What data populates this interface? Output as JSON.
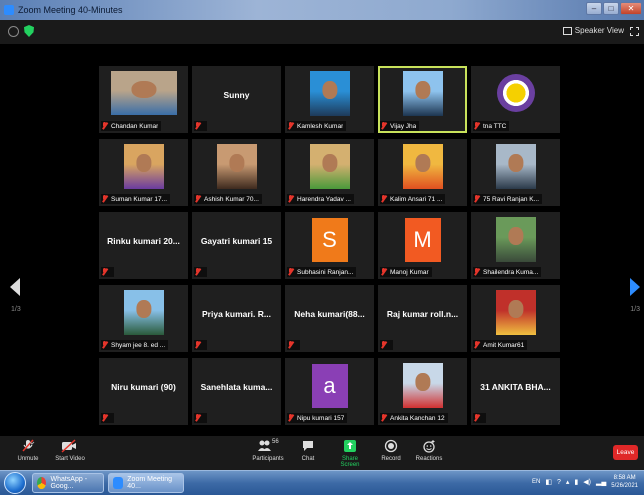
{
  "window": {
    "title": "Zoom Meeting 40-Minutes"
  },
  "topbar": {
    "view_label": "Speaker View"
  },
  "gallery": {
    "page_left": "1/3",
    "page_right": "1/3",
    "tiles": [
      {
        "name": "Chandan Kumar",
        "display": "",
        "type": "video"
      },
      {
        "name": "",
        "display": "Sunny",
        "type": "name"
      },
      {
        "name": "Kamlesh Kumar",
        "display": "",
        "type": "photo"
      },
      {
        "name": "Vijay Jha",
        "display": "",
        "type": "photo"
      },
      {
        "name": "tna TTC",
        "display": "",
        "type": "logo"
      },
      {
        "name": "Suman Kumar 17...",
        "display": "",
        "type": "photo"
      },
      {
        "name": "Ashish Kumar 70...",
        "display": "",
        "type": "photo"
      },
      {
        "name": "Harendra Yadav ...",
        "display": "",
        "type": "photo"
      },
      {
        "name": "Kalim Ansari 71 ...",
        "display": "",
        "type": "photo"
      },
      {
        "name": "75 Ravi Ranjan K...",
        "display": "",
        "type": "photo"
      },
      {
        "name": "",
        "display": "Rinku kumari 20...",
        "type": "name"
      },
      {
        "name": "",
        "display": "Gayatri kumari 15",
        "type": "name"
      },
      {
        "name": "Subhasini Ranjan...",
        "display": "S",
        "type": "avatar",
        "color": "#f07a1a"
      },
      {
        "name": "Manoj Kumar",
        "display": "M",
        "type": "avatar",
        "color": "#f25a22"
      },
      {
        "name": "Shailendra Kuma...",
        "display": "",
        "type": "photo"
      },
      {
        "name": "Shyam jee 8. ed ...",
        "display": "",
        "type": "photo"
      },
      {
        "name": "",
        "display": "Priya kumari. R...",
        "type": "name"
      },
      {
        "name": "",
        "display": "Neha kumari(88...",
        "type": "name"
      },
      {
        "name": "",
        "display": "Raj kumar roll.n...",
        "type": "name"
      },
      {
        "name": "Amit Kumar61",
        "display": "",
        "type": "photo"
      },
      {
        "name": "",
        "display": "Niru kumari (90)",
        "type": "name"
      },
      {
        "name": "",
        "display": "Sanehlata kuma...",
        "type": "name"
      },
      {
        "name": "Nipu kumari 157",
        "display": "a",
        "type": "avatar",
        "color": "#8a3fb5"
      },
      {
        "name": "Ankita Kanchan 12",
        "display": "",
        "type": "photo"
      },
      {
        "name": "",
        "display": "31 ANKITA BHA...",
        "type": "name"
      }
    ]
  },
  "toolbar": {
    "unmute": "Unmute",
    "start_video": "Start Video",
    "participants": "Participants",
    "participants_count": "56",
    "chat": "Chat",
    "share_screen": "Share Screen",
    "record": "Record",
    "reactions": "Reactions",
    "leave": "Leave"
  },
  "taskbar": {
    "task1": "WhatsApp - Goog...",
    "task2": "Zoom Meeting 40...",
    "lang": "EN",
    "time": "8:58 AM",
    "date": "5/26/2021"
  },
  "colors": {
    "active_border": "#c8e25b",
    "share_green": "#23d160",
    "leave_red": "#e02828",
    "mic_red": "#e5352b"
  }
}
